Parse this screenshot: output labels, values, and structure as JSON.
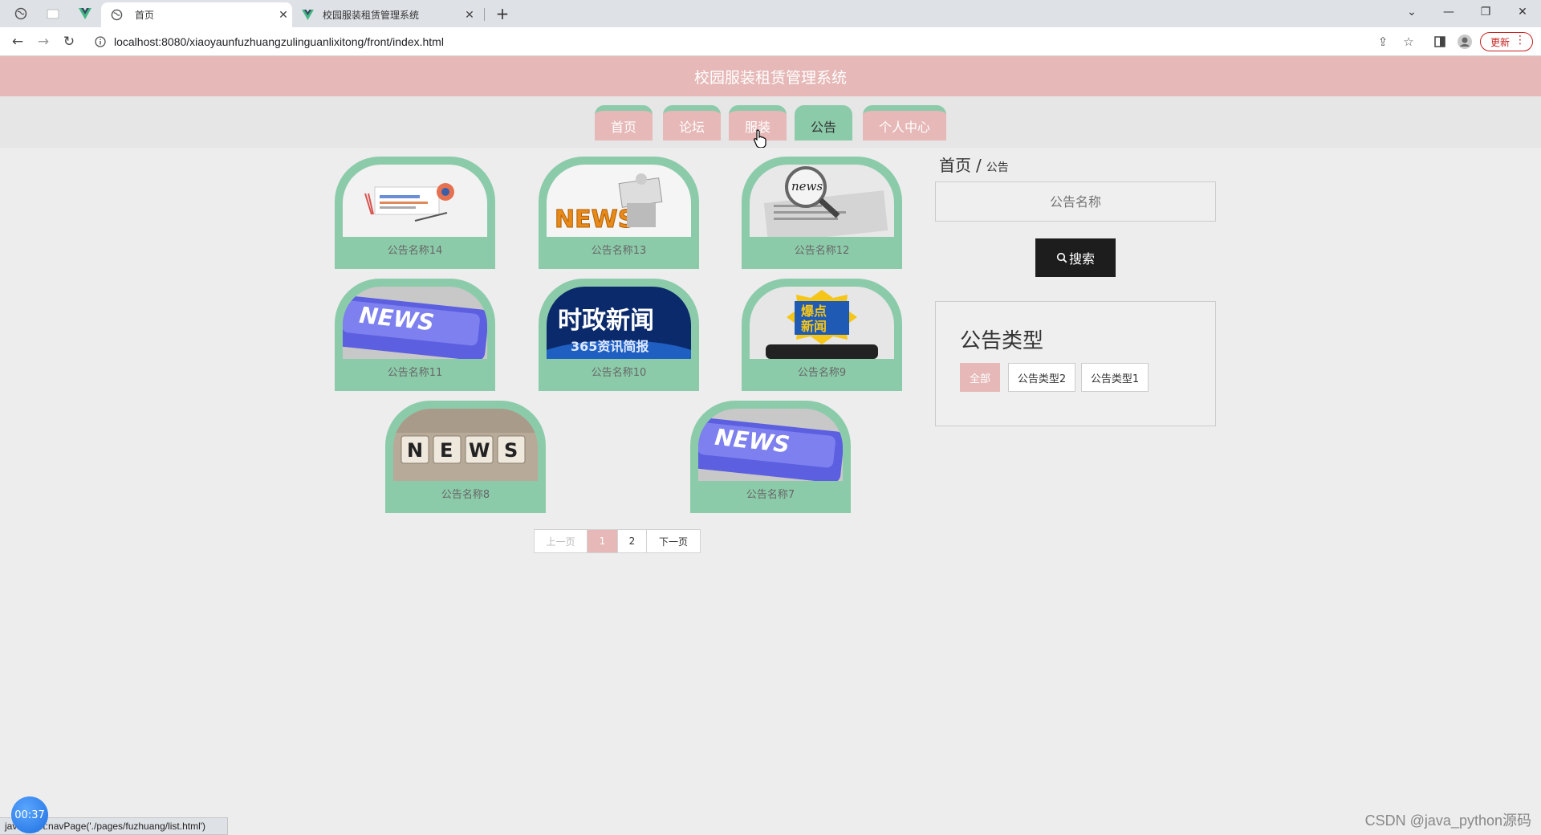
{
  "browser": {
    "tabs": [
      {
        "title": "首页",
        "active": true
      },
      {
        "title": "校园服装租赁管理系统",
        "active": false
      }
    ],
    "url": "localhost:8080/xiaoyaunfuzhuangzulinguanlixitong/front/index.html",
    "update_label": "更新",
    "status_text": "javascript:navPage('./pages/fuzhuang/list.html')"
  },
  "site": {
    "title": "校园服装租赁管理系统",
    "nav": [
      "首页",
      "论坛",
      "服装",
      "公告",
      "个人中心"
    ]
  },
  "cards": [
    {
      "caption": "公告名称14",
      "image": "news-collage"
    },
    {
      "caption": "公告名称13",
      "image": "news-reader"
    },
    {
      "caption": "公告名称12",
      "image": "news-magnifier"
    },
    {
      "caption": "公告名称11",
      "image": "news-keyboard"
    },
    {
      "caption": "公告名称10",
      "image": "politics-news"
    },
    {
      "caption": "公告名称9",
      "image": "breaking-news"
    },
    {
      "caption": "公告名称8",
      "image": "news-blocks"
    },
    {
      "caption": "公告名称7",
      "image": "news-keyboard"
    }
  ],
  "pagination": {
    "prev": "上一页",
    "pages": [
      "1",
      "2"
    ],
    "current": "1",
    "next": "下一页"
  },
  "sidebar": {
    "breadcrumb_home": "首页",
    "breadcrumb_sep": "/",
    "breadcrumb_current": "公告",
    "search_placeholder": "公告名称",
    "search_button": "搜索",
    "type_title": "公告类型",
    "types": [
      "全部",
      "公告类型2",
      "公告类型1"
    ]
  },
  "overlay": {
    "timer": "00:37",
    "watermark": "CSDN @java_python源码"
  },
  "colors": {
    "pink": "#e6b8b7",
    "green": "#8ccbaa",
    "dark": "#1d1d1d"
  }
}
